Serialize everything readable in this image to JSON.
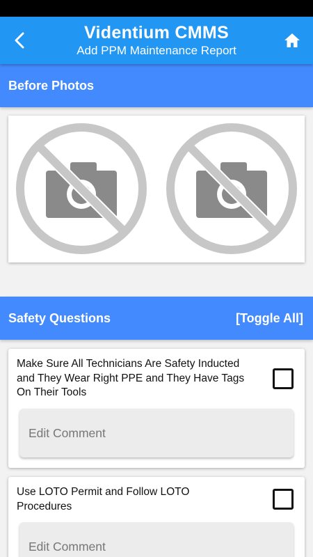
{
  "app_bar": {
    "title": "Videntium CMMS",
    "subtitle": "Add PPM Maintenance Report",
    "back_icon": "back-arrow-icon",
    "home_icon": "home-icon",
    "background_color": "#2196f3"
  },
  "before_photos": {
    "header": "Before Photos",
    "photos": [
      {
        "icon": "no-photo-icon"
      },
      {
        "icon": "no-photo-icon"
      }
    ]
  },
  "safety_questions": {
    "header": "Safety Questions",
    "toggle_all_label": "[Toggle All]",
    "items": [
      {
        "question": "Make Sure All Technicians Are Safety Inducted and They Wear Right PPE and They Have Tags On Their Tools",
        "checked": false,
        "comment_placeholder": "Edit Comment"
      },
      {
        "question": "Use LOTO Permit and Follow LOTO Procedures",
        "checked": false,
        "comment_placeholder": "Edit Comment"
      }
    ]
  },
  "colors": {
    "header_accent": "#448aff",
    "page_background": "#f2f2f2"
  }
}
